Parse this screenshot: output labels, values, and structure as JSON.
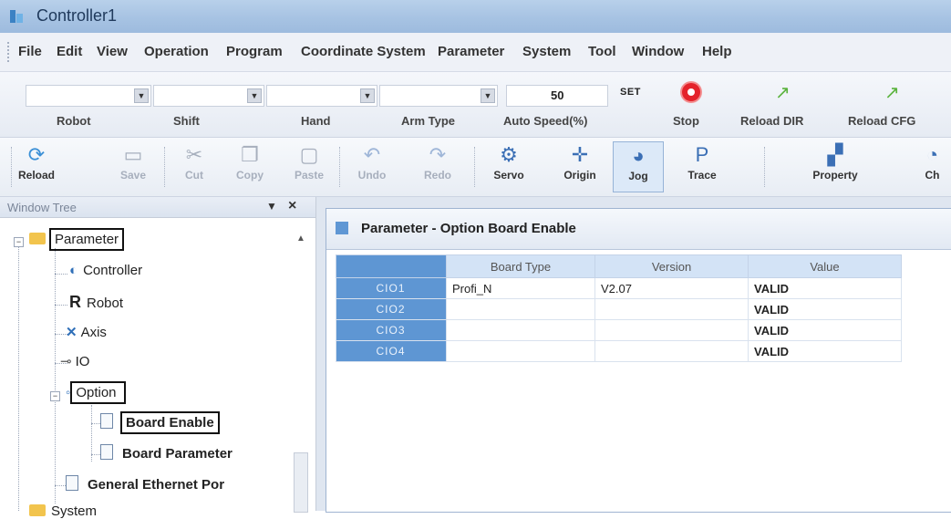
{
  "window": {
    "title": "Controller1"
  },
  "menu": [
    "File",
    "Edit",
    "View",
    "Operation",
    "Program",
    "Coordinate System",
    "Parameter",
    "System",
    "Tool",
    "Window",
    "Help"
  ],
  "toolbar1": {
    "labels": {
      "robot": "Robot",
      "shift": "Shift",
      "hand": "Hand",
      "arm_type": "Arm Type",
      "auto_speed": "Auto Speed(%)",
      "stop": "Stop",
      "reload_dir": "Reload DIR",
      "reload_cfg": "Reload CFG"
    },
    "auto_speed_value": "50",
    "set_label": "SET"
  },
  "toolbar2": [
    "Reload",
    "Save",
    "Cut",
    "Copy",
    "Paste",
    "Undo",
    "Redo",
    "Servo",
    "Origin",
    "Jog",
    "Trace",
    "Property",
    "Ch"
  ],
  "sidebar": {
    "title": "Window Tree",
    "items": [
      "Parameter",
      "Controller",
      "Robot",
      "Axis",
      "IO",
      "Option",
      "Board Enable",
      "Board Parameter",
      "General Ethernet Por",
      "System"
    ],
    "robot_icon": "R"
  },
  "document": {
    "title": "Parameter - Option Board Enable",
    "columns": [
      "Board Type",
      "Version",
      "Value"
    ],
    "rows": [
      {
        "id": "CIO1",
        "board_type": "Profi_N",
        "version": "V2.07",
        "value": "VALID"
      },
      {
        "id": "CIO2",
        "board_type": "",
        "version": "",
        "value": "VALID"
      },
      {
        "id": "CIO3",
        "board_type": "",
        "version": "",
        "value": "VALID"
      },
      {
        "id": "CIO4",
        "board_type": "",
        "version": "",
        "value": "VALID"
      }
    ]
  },
  "colors": {
    "title_bar": "#a7c3e3",
    "row_header": "#5e96d3",
    "stop_red": "#e4232b"
  }
}
